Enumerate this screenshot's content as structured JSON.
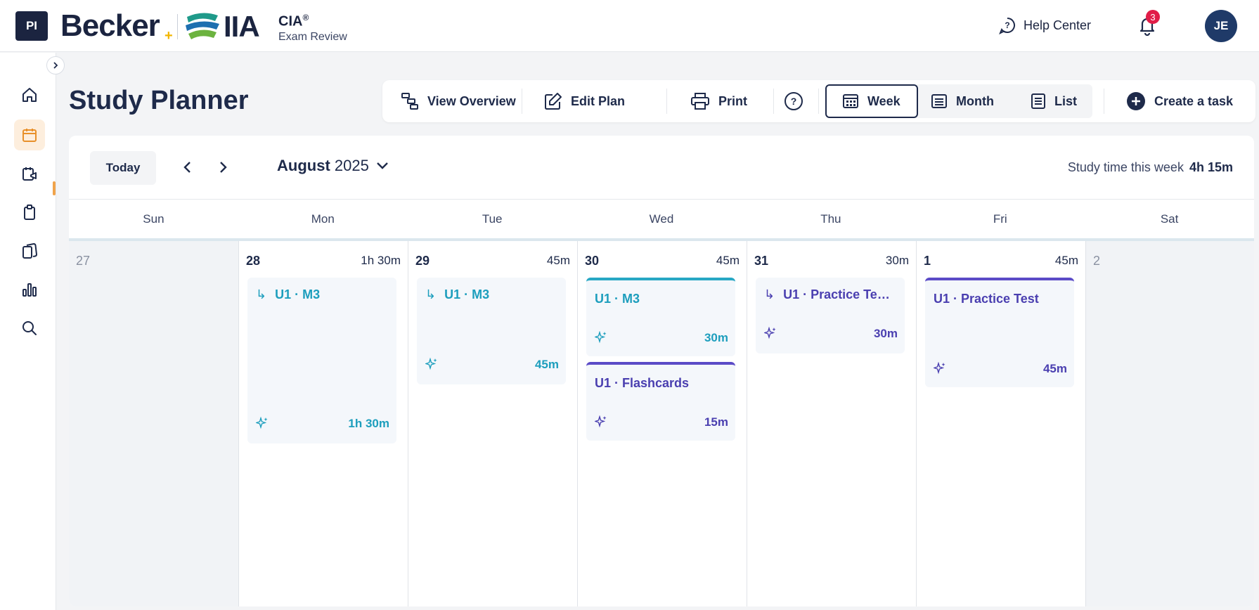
{
  "header": {
    "badge": "PI",
    "brand": "Becker",
    "partner": "IIA",
    "product": "CIA",
    "product_mark": "®",
    "product_sub": "Exam Review",
    "help_label": "Help Center",
    "notification_count": "3",
    "avatar_initials": "JE"
  },
  "sidebar": {
    "items": [
      {
        "name": "home",
        "icon": "home-icon"
      },
      {
        "name": "study-planner",
        "icon": "calendar-icon",
        "active": true
      },
      {
        "name": "live-classes",
        "icon": "calendar-video-icon"
      },
      {
        "name": "clipboard",
        "icon": "clipboard-icon"
      },
      {
        "name": "flashcards",
        "icon": "cards-icon"
      },
      {
        "name": "performance",
        "icon": "bar-chart-icon"
      },
      {
        "name": "search",
        "icon": "search-icon"
      }
    ]
  },
  "page": {
    "title": "Study Planner"
  },
  "toolbar": {
    "view_overview": "View Overview",
    "edit_plan": "Edit Plan",
    "print": "Print",
    "week": "Week",
    "month": "Month",
    "list": "List",
    "create_task": "Create a task"
  },
  "calendar": {
    "today_label": "Today",
    "month": "August",
    "year": "2025",
    "study_time_label": "Study time this week",
    "study_time_value": "4h 15m",
    "weekdays": [
      "Sun",
      "Mon",
      "Tue",
      "Wed",
      "Thu",
      "Fri",
      "Sat"
    ],
    "days": [
      {
        "num": "27",
        "duration": ""
      },
      {
        "num": "28",
        "duration": "1h 30m"
      },
      {
        "num": "29",
        "duration": "45m"
      },
      {
        "num": "30",
        "duration": "45m"
      },
      {
        "num": "31",
        "duration": "30m"
      },
      {
        "num": "1",
        "duration": "45m"
      },
      {
        "num": "2",
        "duration": ""
      }
    ],
    "tasks": {
      "mon": {
        "title": "U1 · M3",
        "duration": "1h 30m"
      },
      "tue": {
        "title": "U1 · M3",
        "duration": "45m"
      },
      "wed1": {
        "title": "U1 · M3",
        "duration": "30m"
      },
      "wed2": {
        "title": "U1 · Flashcards",
        "duration": "15m"
      },
      "thu": {
        "title": "U1 · Practice Te…",
        "duration": "30m"
      },
      "fri": {
        "title": "U1 · Practice Test",
        "duration": "45m"
      }
    },
    "subtask_arrow": "↳"
  },
  "colors": {
    "navy": "#1e2a4a",
    "teal": "#1d9ebd",
    "purple": "#4a3fb0",
    "accent_orange": "#f0a34a",
    "notification_red": "#e11d48"
  }
}
